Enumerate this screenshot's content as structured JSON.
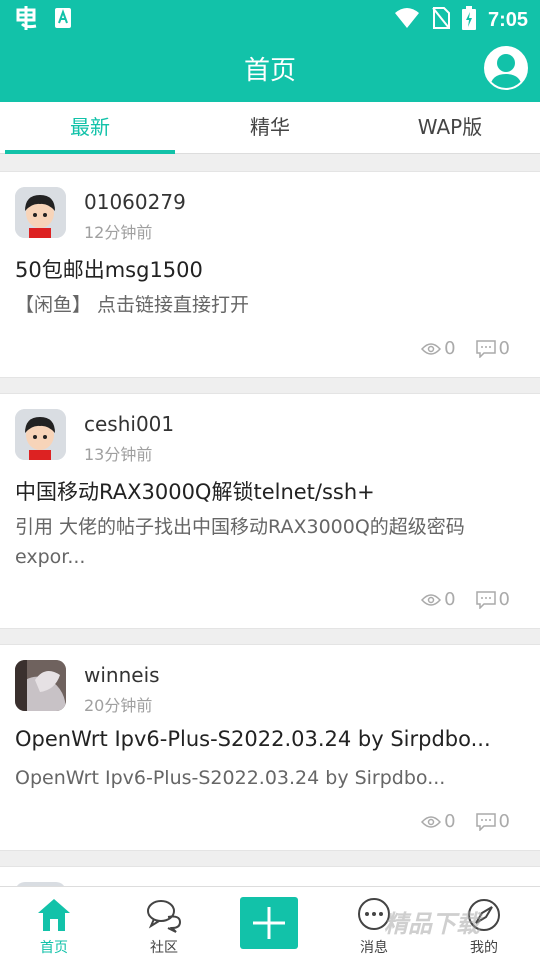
{
  "status_bar": {
    "time": "7:05",
    "left_icons": [
      "app-icon",
      "a-icon"
    ],
    "right_icons": [
      "wifi-icon",
      "no-sim-icon",
      "battery-charging-icon"
    ]
  },
  "app_bar": {
    "title": "首页"
  },
  "tabs": [
    {
      "label": "最新",
      "active": true
    },
    {
      "label": "精华",
      "active": false
    },
    {
      "label": "WAP版",
      "active": false
    }
  ],
  "posts": [
    {
      "username": "01060279",
      "time": "12分钟前",
      "title": "50包邮出msg1500",
      "excerpt": "【闲鱼】 点击链接直接打开",
      "views": "0",
      "comments": "0"
    },
    {
      "username": "ceshi001",
      "time": "13分钟前",
      "title": "中国移动RAX3000Q解锁telnet/ssh+",
      "excerpt": "引用  大佬的帖子找出中国移动RAX3000Q的超级密码expor...",
      "views": "0",
      "comments": "0"
    },
    {
      "username": "winneis",
      "time": "20分钟前",
      "title": "OpenWrt Ipv6-Plus-S2022.03.24 by Sirpdbo...",
      "excerpt": "OpenWrt Ipv6-Plus-S2022.03.24 by Sirpdbo...",
      "views": "0",
      "comments": "0"
    }
  ],
  "bottom_nav": [
    {
      "label": "首页",
      "icon": "home-icon",
      "active": true
    },
    {
      "label": "社区",
      "icon": "chat-bubbles-icon",
      "active": false
    },
    {
      "label": "",
      "icon": "plus-icon",
      "active": false
    },
    {
      "label": "消息",
      "icon": "message-icon",
      "active": false
    },
    {
      "label": "我的",
      "icon": "compass-icon",
      "active": false
    }
  ],
  "watermark": "精品下载",
  "colors": {
    "accent": "#12c2a9",
    "background": "#efefef"
  }
}
